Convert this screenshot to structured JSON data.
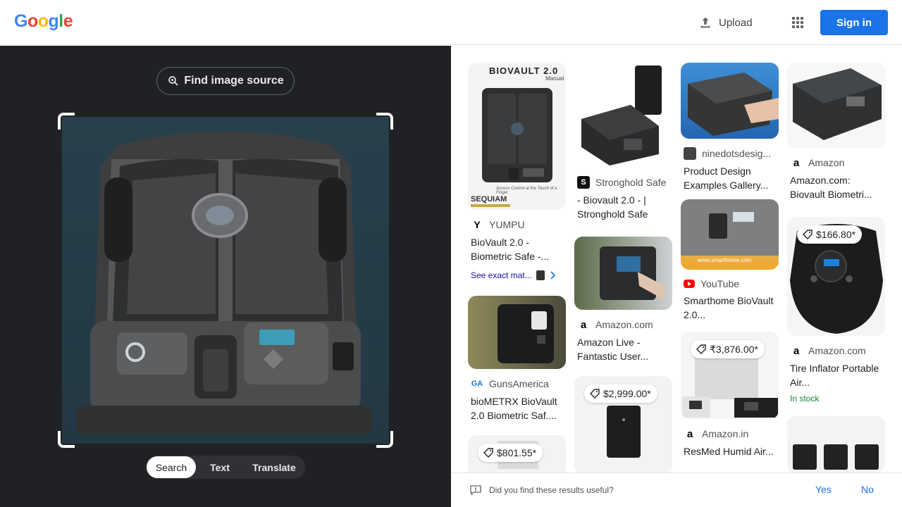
{
  "header": {
    "logo_letters": [
      "G",
      "o",
      "o",
      "g",
      "l",
      "e"
    ],
    "upload_label": "Upload",
    "signin_label": "Sign in"
  },
  "left": {
    "find_source_label": "Find image source",
    "tabs": [
      "Search",
      "Text",
      "Translate"
    ],
    "active_tab": "Search"
  },
  "results": {
    "col1": [
      {
        "source": "YUMPU",
        "title": "BioVault 2.0 - Biometric Safe -...",
        "exact_label": "See exact mat...",
        "thumb_text_top": "BIOVAULT 2.0",
        "thumb_text_sub": "Manual",
        "thumb_text_bottom": "SEQUIAM",
        "thumb_caption": "Access Control at the Touch of a Finger"
      },
      {
        "source": "GunsAmerica",
        "title": "bioMETRX BioVault 2.0 Biometric Saf...."
      },
      {
        "price": "$801.55*"
      }
    ],
    "col2": [
      {
        "source": "Stronghold Safe",
        "title": "- Biovault 2.0 - | Stronghold Safe"
      },
      {
        "source": "Amazon.com",
        "title": "Amazon Live - Fantastic User..."
      },
      {
        "price": "$2,999.00*"
      }
    ],
    "col3": [
      {
        "source": "ninedotsdesig...",
        "title": "Product Design Examples Gallery..."
      },
      {
        "source": "YouTube",
        "title": "Smarthome BioVault 2.0...",
        "thumb_url": "www.smarthome.com"
      },
      {
        "price": "₹3,876.00*",
        "source": "Amazon.in",
        "title": "ResMed Humid Air..."
      }
    ],
    "col4": [
      {
        "source": "Amazon",
        "title": "Amazon.com: Biovault Biometri..."
      },
      {
        "price": "$166.80*",
        "source": "Amazon.com",
        "title": "Tire Inflator Portable Air...",
        "stock": "In stock"
      },
      {}
    ]
  },
  "feedback": {
    "question": "Did you find these results useful?",
    "yes": "Yes",
    "no": "No"
  },
  "colors": {
    "google_blue": "#4285F4",
    "google_red": "#EA4335",
    "google_yellow": "#FBBC05",
    "google_green": "#34A853",
    "accent": "#1a73e8",
    "dark_bg": "#202124"
  }
}
